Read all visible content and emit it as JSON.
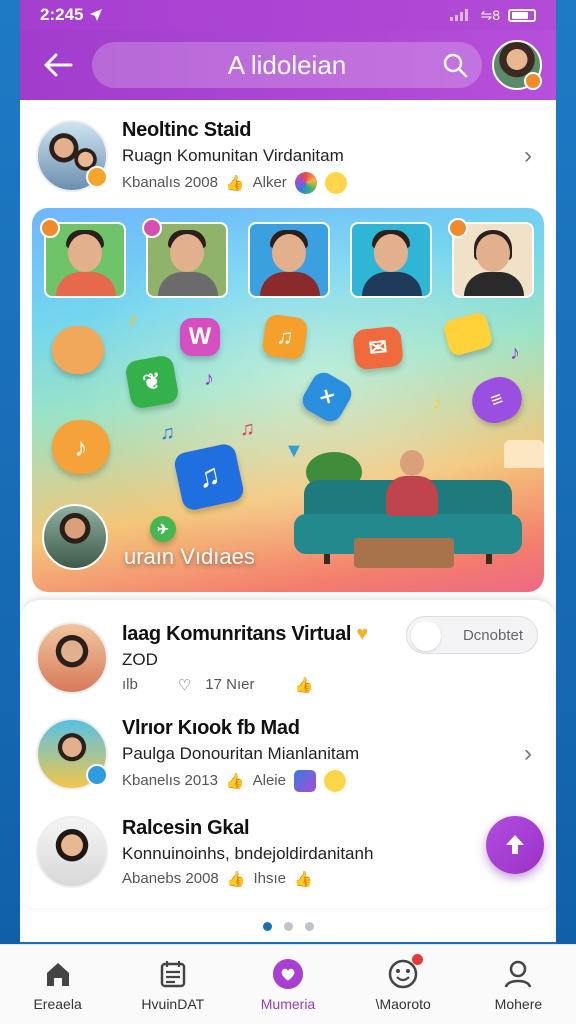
{
  "status": {
    "time": "2:245",
    "signal_text": "⇋8"
  },
  "header": {
    "title": "A lidoleian"
  },
  "featured_post": {
    "title": "Neoltinc Staid",
    "subtitle": "Ruagn Komunitan Virdanitam",
    "meta": "Kbanalıs 2008",
    "meta_extra": "Alker"
  },
  "hero": {
    "label": "uraın Vıdıaes"
  },
  "list": [
    {
      "title": "laag Komunritans Virtual",
      "subtitle": "ZOD",
      "meta_left": "ılb",
      "meta_count": "17 Nıer",
      "action": "Dcnobtet"
    },
    {
      "title": "Vlrıor Kıook  fb Mad",
      "subtitle": "Paulga Donouritan Mianlanitam",
      "meta": "Kbanelıs 2013",
      "meta_extra": "Aleie"
    },
    {
      "title": "Ralcesin Gkal",
      "subtitle": "Konnuinoinhs, bndejoldirdanitanh",
      "meta": "Abanebs 2008",
      "meta_extra": "Ihsıe"
    }
  ],
  "bottom_nav": [
    {
      "label": "Ereaela",
      "icon": "home-icon"
    },
    {
      "label": "HvuinDAT",
      "icon": "calendar-icon"
    },
    {
      "label": "Mumeria",
      "icon": "heart-chat-icon"
    },
    {
      "label": "\\Maoroto",
      "icon": "emoji-notification-icon"
    },
    {
      "label": "Mohere",
      "icon": "profile-icon"
    }
  ],
  "colors": {
    "accent": "#a63fd0",
    "frame": "#1a6fb5",
    "fab": "#b14de0"
  }
}
